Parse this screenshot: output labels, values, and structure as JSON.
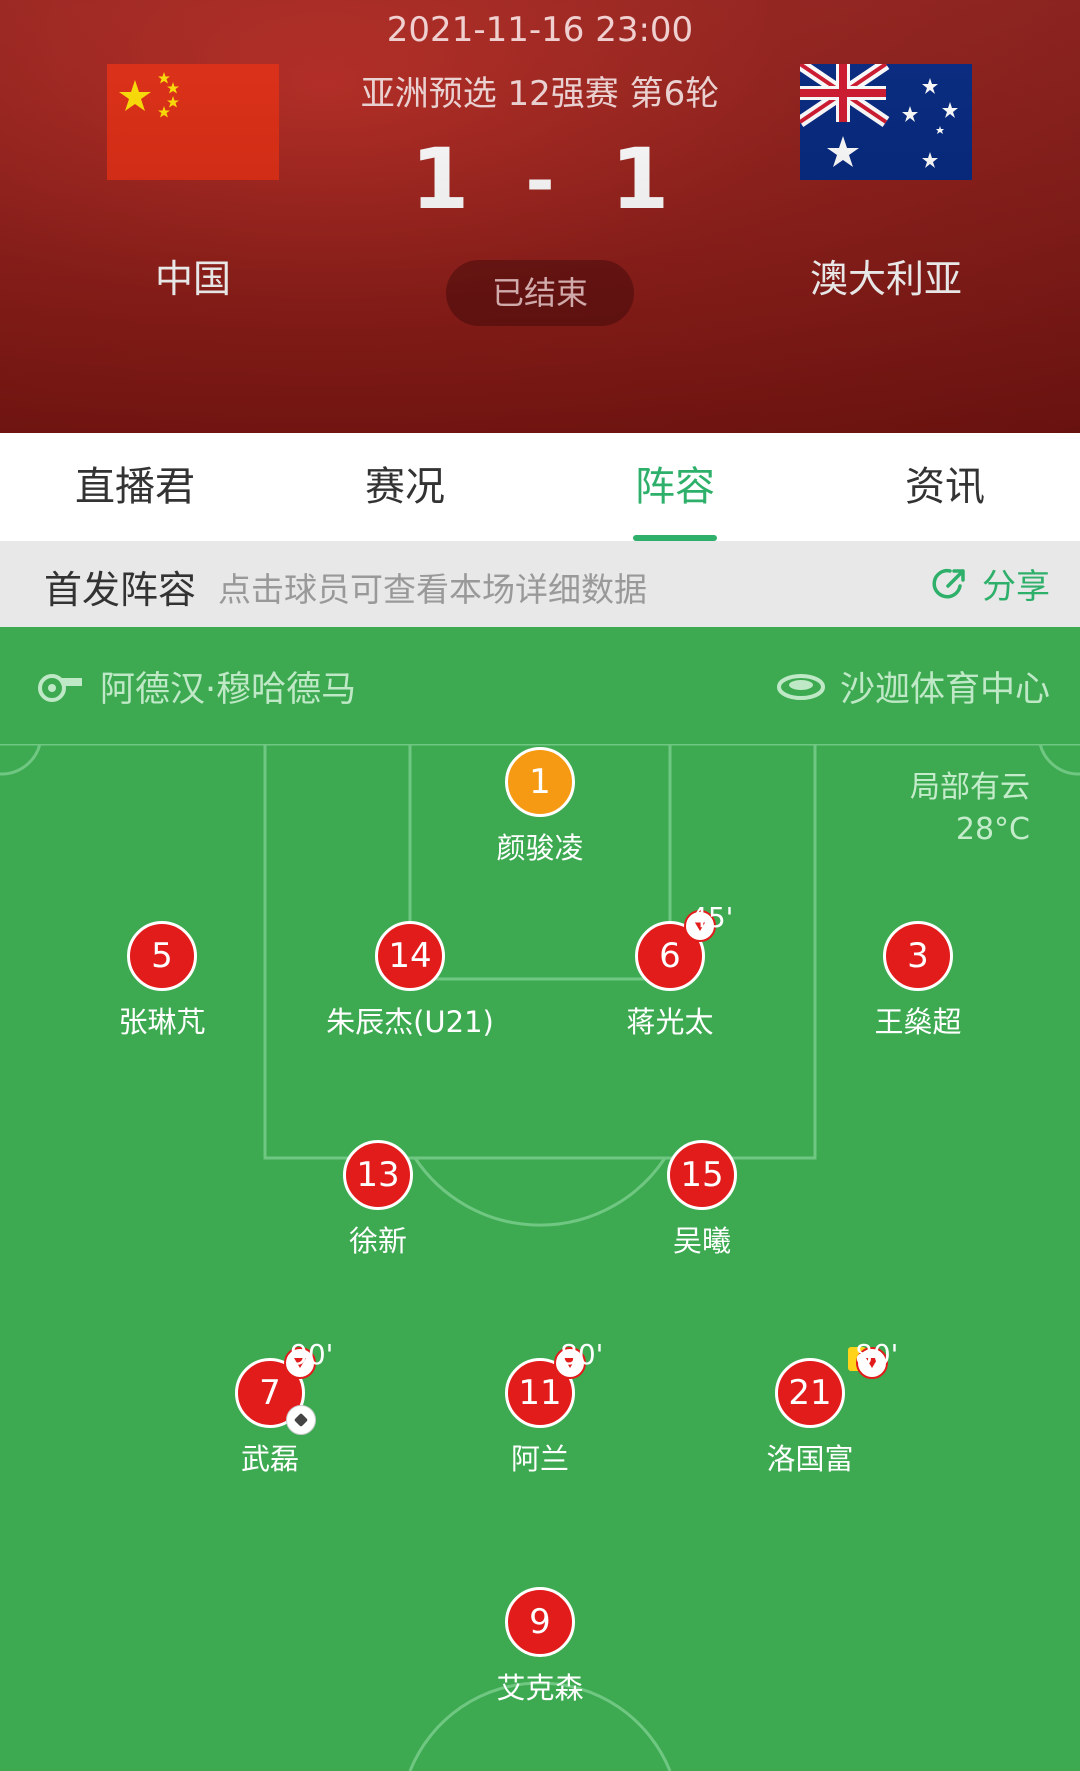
{
  "match": {
    "datetime": "2021-11-16 23:00",
    "competition": "亚洲预选 12强赛 第6轮",
    "home_score": "1",
    "separator": "-",
    "away_score": "1",
    "status": "已结束",
    "home_team": "中国",
    "away_team": "澳大利亚"
  },
  "tabs": [
    "直播君",
    "赛况",
    "阵容",
    "资讯"
  ],
  "active_tab": "阵容",
  "lineup_bar": {
    "title": "首发阵容",
    "hint": "点击球员可查看本场详细数据",
    "share_label": "分享"
  },
  "pitch_info": {
    "coach": "阿德汉·穆哈德马",
    "venue": "沙迦体育中心",
    "weather": "局部有云",
    "temperature": "28°C"
  },
  "players": [
    {
      "number": "1",
      "name": "颜骏凌",
      "position": "goalkeeper"
    },
    {
      "number": "5",
      "name": "张琳芃"
    },
    {
      "number": "14",
      "name": "朱辰杰(U21)"
    },
    {
      "number": "6",
      "name": "蒋光太",
      "sub_out": "45'"
    },
    {
      "number": "3",
      "name": "王燊超"
    },
    {
      "number": "13",
      "name": "徐新"
    },
    {
      "number": "15",
      "name": "吴曦"
    },
    {
      "number": "7",
      "name": "武磊",
      "sub_out": "90'",
      "goal": true
    },
    {
      "number": "11",
      "name": "阿兰",
      "sub_out": "80'"
    },
    {
      "number": "21",
      "name": "洛国富",
      "sub_out": "80'",
      "yellow_card": true
    },
    {
      "number": "9",
      "name": "艾克森"
    }
  ],
  "colors": {
    "header_red": "#8f1b16",
    "accent_green": "#2fb06a",
    "pitch_green": "#3daa52",
    "player_red": "#e21b1b",
    "goalkeeper_orange": "#f59a12"
  }
}
